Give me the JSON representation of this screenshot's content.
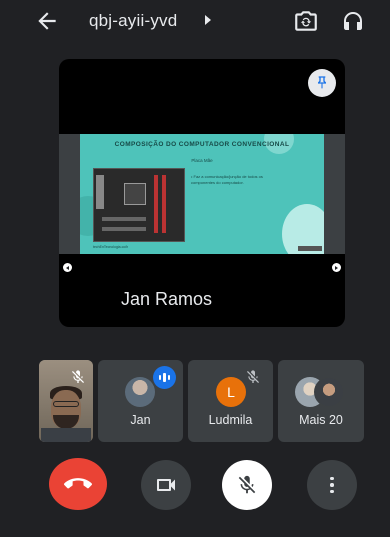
{
  "header": {
    "meeting_code": "qbj-ayii-yvd",
    "icons": [
      "arrow-back-icon",
      "caret-right-icon",
      "switch-camera-icon",
      "headphones-icon"
    ]
  },
  "presentation": {
    "slide": {
      "title": "COMPOSIÇÃO DO COMPUTADOR CONVENCIONAL",
      "subtitle": "Placa Mãe",
      "bullet": "• Faz a comunicação/junção de todos os componentes do computador.",
      "caption": "techEnTecnologia.co/h"
    },
    "presenter_name": "Jan Ramos",
    "pin_icon": "pin-icon"
  },
  "participants": [
    {
      "label": "",
      "type": "self-video",
      "mic": "off"
    },
    {
      "label": "Jan",
      "type": "avatar",
      "status": "speaking"
    },
    {
      "label": "Ludmila",
      "type": "initial",
      "initial": "L",
      "color": "#e8710a",
      "mic": "off"
    },
    {
      "label": "Mais 20",
      "type": "group"
    }
  ],
  "controls": {
    "end_call_color": "#ea4335",
    "icons": [
      "end-call-icon",
      "videocam-icon",
      "mic-off-icon",
      "more-vert-icon"
    ]
  },
  "colors": {
    "background": "#202124",
    "tile": "#3c4043",
    "accent": "#1a73e8"
  }
}
